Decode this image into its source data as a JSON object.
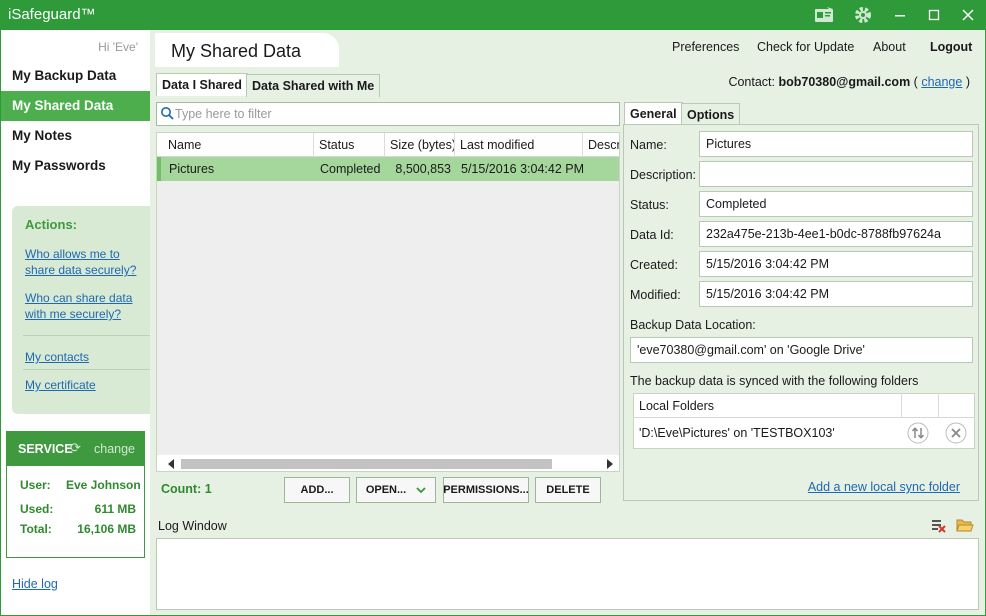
{
  "app": {
    "title": "iSafeguard™",
    "icons": [
      "id-card-icon",
      "gear-icon",
      "minimize-icon",
      "maximize-icon",
      "close-icon"
    ],
    "accent": "#2e9a3a"
  },
  "sidebar": {
    "greeting": "Hi 'Eve'",
    "items": [
      {
        "label": "My Backup Data"
      },
      {
        "label": "My Shared Data"
      },
      {
        "label": "My Notes"
      },
      {
        "label": "My Passwords"
      }
    ],
    "active_index": 1,
    "actions": {
      "title": "Actions:",
      "links": [
        {
          "line1": "Who allows me to",
          "line2": "share data securely?"
        },
        {
          "line1": "Who can share data",
          "line2": "with me securely?"
        },
        {
          "line1": "My contacts"
        },
        {
          "line1": "My certificate"
        }
      ]
    },
    "service": {
      "title": "SERVICE",
      "change": "change",
      "user_label": "User:",
      "user_value": "Eve Johnson",
      "used_label": "Used:",
      "used_value": "611 MB",
      "total_label": "Total:",
      "total_value": "16,106 MB"
    },
    "hide_log": "Hide log"
  },
  "header": {
    "page_title": "My Shared Data",
    "menu": [
      "Preferences",
      "Check for Update",
      "About",
      "Logout"
    ],
    "contact_label": "Contact:",
    "contact_email": "bob70380@gmail.com",
    "contact_change": "change",
    "paren_open": "(",
    "paren_close": ")"
  },
  "tabs": {
    "main": [
      "Data I Shared",
      "Data Shared with Me"
    ],
    "details": [
      "General",
      "Options"
    ]
  },
  "filter": {
    "placeholder": "Type here to filter",
    "value": ""
  },
  "grid": {
    "columns": [
      "Name",
      "Status",
      "Size (bytes)",
      "Last modified",
      "Descri"
    ],
    "rows": [
      {
        "name": "Pictures",
        "status": "Completed",
        "size": "8,500,853",
        "modified": "5/15/2016 3:04:42 PM",
        "description": ""
      }
    ]
  },
  "bottom": {
    "count": "Count: 1",
    "buttons": {
      "add": "ADD...",
      "open": "OPEN...",
      "permissions": "PERMISSIONS...",
      "delete": "DELETE"
    }
  },
  "details": {
    "name_label": "Name:",
    "name_value": "Pictures",
    "description_label": "Description:",
    "description_value": "",
    "status_label": "Status:",
    "status_value": "Completed",
    "dataid_label": "Data Id:",
    "dataid_value": "232a475e-213b-4ee1-b0dc-8788fb97624a",
    "created_label": "Created:",
    "created_value": "5/15/2016 3:04:42 PM",
    "modified_label": "Modified:",
    "modified_value": "5/15/2016 3:04:42 PM",
    "location_label": "Backup Data Location:",
    "location_value": "'eve70380@gmail.com' on 'Google Drive'",
    "synced_text": "The backup data is synced with the following folders",
    "folders_header": "Local Folders",
    "folders": [
      {
        "path": "'D:\\Eve\\Pictures' on 'TESTBOX103'"
      }
    ],
    "add_sync": "Add a new local sync folder"
  },
  "log": {
    "title": "Log Window"
  }
}
